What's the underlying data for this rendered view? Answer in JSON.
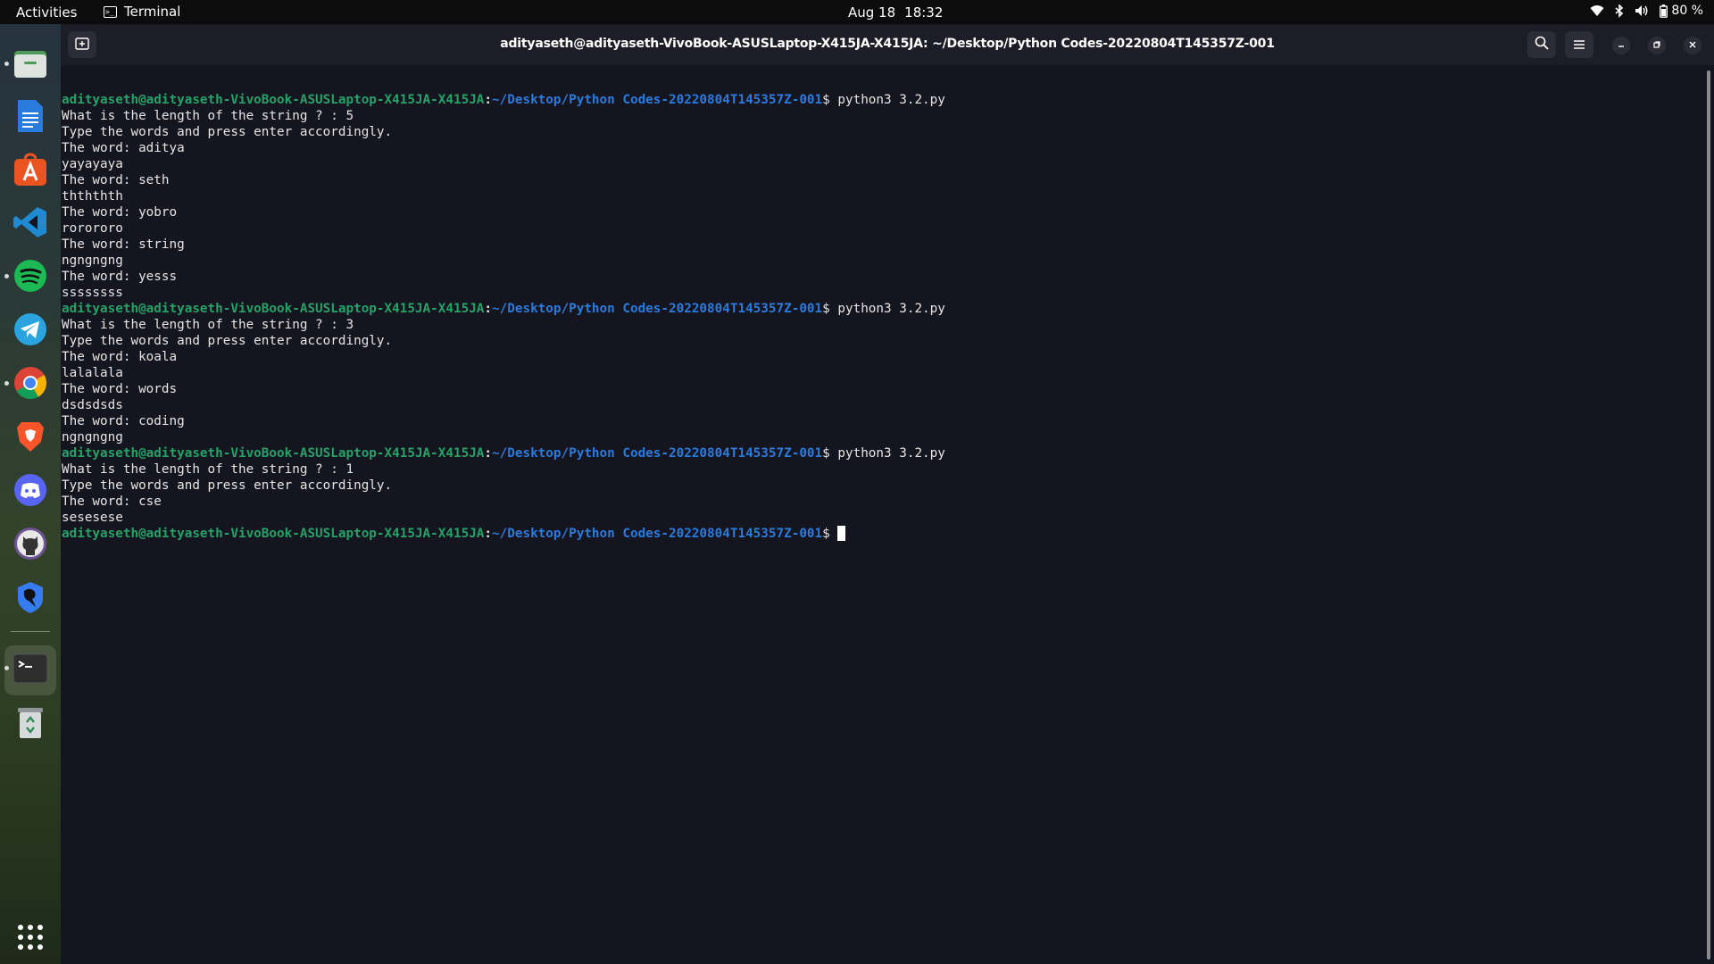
{
  "topbar": {
    "activities": "Activities",
    "app_name": "Terminal",
    "date": "Aug 18",
    "time": "18:32",
    "battery": "80 %"
  },
  "dock": {
    "items": [
      {
        "name": "files-icon",
        "color": "#4e9a56"
      },
      {
        "name": "libreoffice-writer-icon",
        "color": "#2a7bde"
      },
      {
        "name": "ubuntu-software-icon",
        "color": "#e95420"
      },
      {
        "name": "vscode-icon",
        "color": "#1f8ad2"
      },
      {
        "name": "spotify-icon",
        "color": "#1db954"
      },
      {
        "name": "telegram-icon",
        "color": "#2aa3df"
      },
      {
        "name": "chrome-icon",
        "color": "#db4437"
      },
      {
        "name": "brave-icon",
        "color": "#fb542b"
      },
      {
        "name": "discord-icon",
        "color": "#5865f2"
      },
      {
        "name": "github-icon",
        "color": "#6e5494"
      },
      {
        "name": "kali-icon",
        "color": "#367bf0"
      },
      {
        "name": "terminal-icon",
        "color": "#2e2e2e"
      },
      {
        "name": "trash-icon",
        "color": "#8f9599"
      },
      {
        "name": "show-apps-icon",
        "color": "#ffffff"
      }
    ]
  },
  "window": {
    "title": "adityaseth@adityaseth-VivoBook-ASUSLaptop-X415JA-X415JA: ~/Desktop/Python Codes-20220804T145357Z-001"
  },
  "terminal": {
    "prompt_user": "adityaseth@adityaseth-VivoBook-ASUSLaptop-X415JA-X415JA",
    "prompt_colon": ":",
    "prompt_path": "~/Desktop/Python Codes-20220804T145357Z-001",
    "prompt_dollar": "$ ",
    "command": "python3 3.2.py",
    "lines": [
      {
        "type": "prompt",
        "cmd": "python3 3.2.py"
      },
      {
        "type": "out",
        "text": "What is the length of the string ? : 5"
      },
      {
        "type": "out",
        "text": "Type the words and press enter accordingly."
      },
      {
        "type": "out",
        "text": "The word: aditya"
      },
      {
        "type": "out",
        "text": "yayayaya"
      },
      {
        "type": "out",
        "text": "The word: seth"
      },
      {
        "type": "out",
        "text": "thththth"
      },
      {
        "type": "out",
        "text": "The word: yobro"
      },
      {
        "type": "out",
        "text": "rorororo"
      },
      {
        "type": "out",
        "text": "The word: string"
      },
      {
        "type": "out",
        "text": "ngngngng"
      },
      {
        "type": "out",
        "text": "The word: yesss"
      },
      {
        "type": "out",
        "text": "ssssssss"
      },
      {
        "type": "prompt",
        "cmd": "python3 3.2.py"
      },
      {
        "type": "out",
        "text": "What is the length of the string ? : 3"
      },
      {
        "type": "out",
        "text": "Type the words and press enter accordingly."
      },
      {
        "type": "out",
        "text": "The word: koala"
      },
      {
        "type": "out",
        "text": "lalalala"
      },
      {
        "type": "out",
        "text": "The word: words"
      },
      {
        "type": "out",
        "text": "dsdsdsds"
      },
      {
        "type": "out",
        "text": "The word: coding"
      },
      {
        "type": "out",
        "text": "ngngngng"
      },
      {
        "type": "prompt",
        "cmd": "python3 3.2.py"
      },
      {
        "type": "out",
        "text": "What is the length of the string ? : 1"
      },
      {
        "type": "out",
        "text": "Type the words and press enter accordingly."
      },
      {
        "type": "out",
        "text": "The word: cse"
      },
      {
        "type": "out",
        "text": "sesesese"
      },
      {
        "type": "prompt",
        "cmd": ""
      }
    ]
  }
}
